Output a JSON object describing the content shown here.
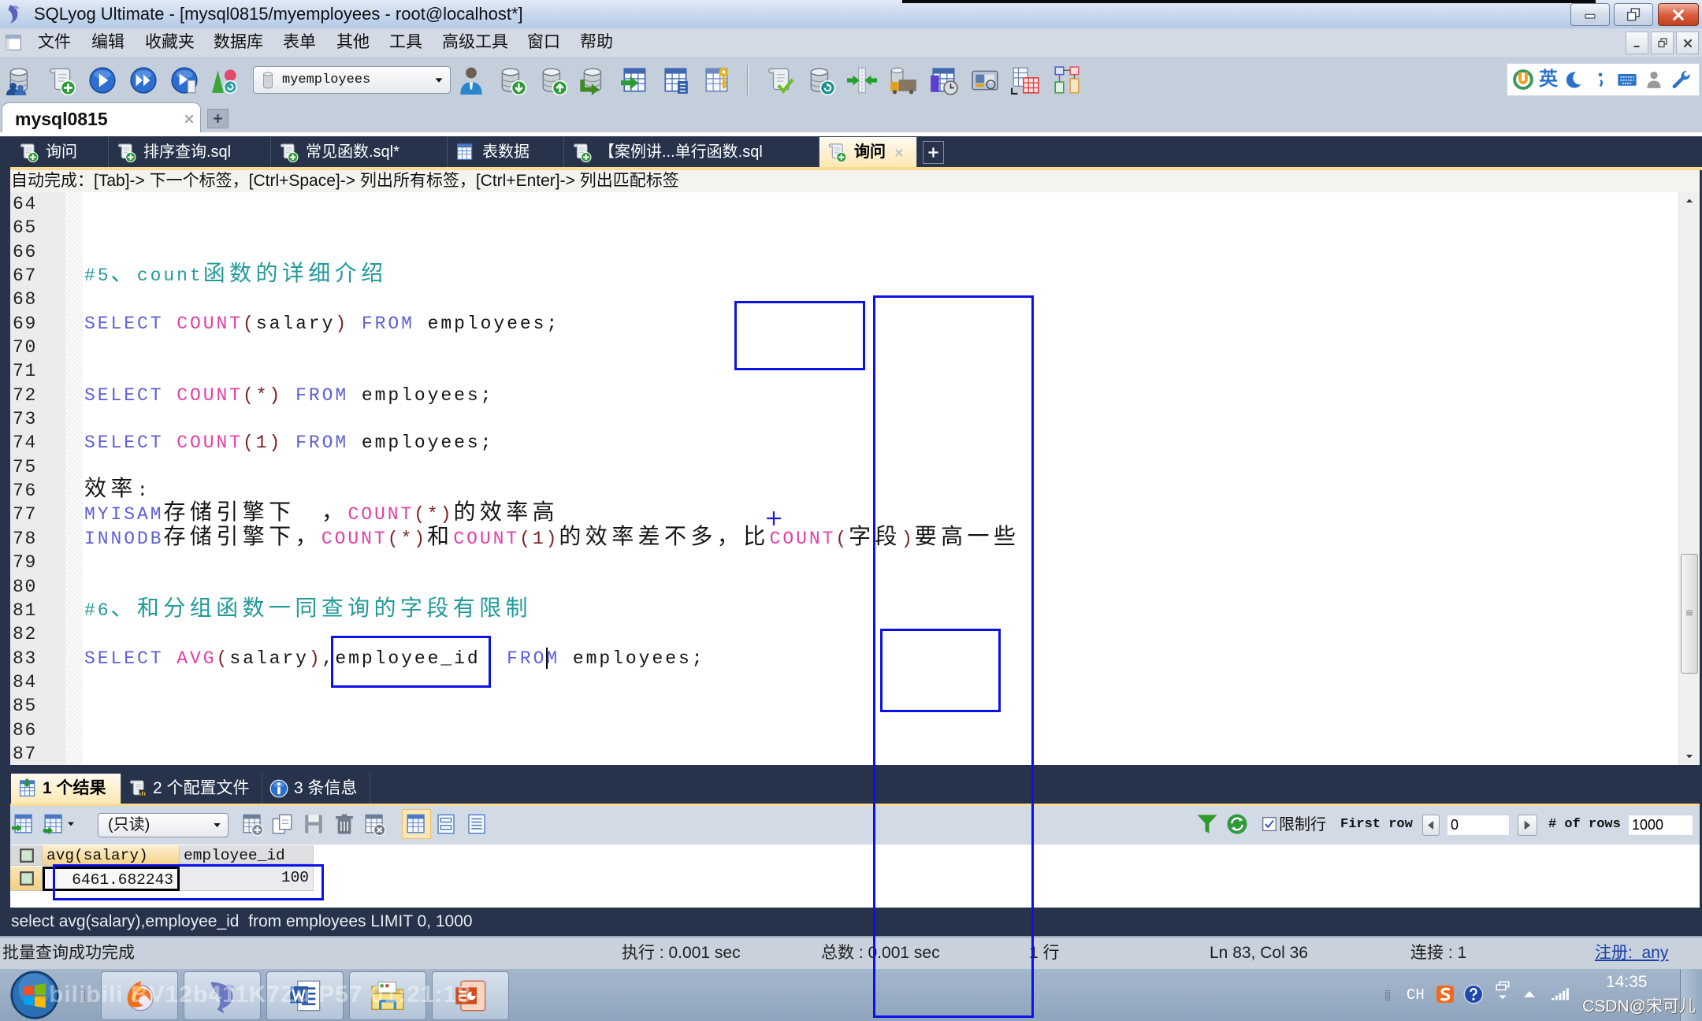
{
  "window": {
    "title": "SQLyog Ultimate - [mysql0815/myemployees - root@localhost*]",
    "app_icon": "sqlyog-logo-icon",
    "controls": [
      "minimize-icon",
      "restore-icon",
      "close-icon"
    ]
  },
  "menu": {
    "items": [
      "文件",
      "编辑",
      "收藏夹",
      "数据库",
      "表单",
      "其他",
      "工具",
      "高级工具",
      "窗口",
      "帮助"
    ]
  },
  "toolbar": {
    "group1": [
      "new-connection-icon",
      "new-query-icon",
      "execute-query-icon",
      "execute-all-queries-icon",
      "execute-and-edit-icon",
      "schema-objects-icon"
    ],
    "database_select": "myemployees",
    "group2": [
      "user-manager-icon",
      "backup-database-icon",
      "restore-database-icon",
      "copy-database-icon",
      "import-table-icon",
      "table-diagnostics-icon",
      "manage-indexes-icon"
    ],
    "group3": [
      "format-sql-icon",
      "refresh-database-icon",
      "schema-sync-icon",
      "import-external-data-icon",
      "scheduled-backup-icon",
      "data-compare-icon",
      "table-designer-icon",
      "schema-designer-icon"
    ]
  },
  "ime_bar": {
    "language": "英",
    "icons": [
      "ime-logo-icon",
      "moon-icon",
      "punctuation-icon",
      "keyboard-icon",
      "user-icon",
      "wrench-icon"
    ]
  },
  "connection_tab": {
    "label": "mysql0815"
  },
  "query_tabs": [
    {
      "label": "询问",
      "icon": "query-file-icon"
    },
    {
      "label": "排序查询.sql",
      "icon": "query-file-icon"
    },
    {
      "label": "常见函数.sql*",
      "icon": "query-file-icon"
    },
    {
      "label": "表数据",
      "icon": "table-data-icon"
    },
    {
      "label": "【案例讲...单行函数.sql",
      "icon": "query-file-icon"
    },
    {
      "label": "询问",
      "icon": "query-file-icon",
      "active": true
    }
  ],
  "editor": {
    "autocomplete_hint": "自动完成：[Tab]-> 下一个标签，[Ctrl+Space]-> 列出所有标签，[Ctrl+Enter]-> 列出匹配标签",
    "cursor": {
      "line": 83,
      "col": 36
    },
    "lines": [
      {
        "n": 64,
        "tokens": []
      },
      {
        "n": 65,
        "tokens": []
      },
      {
        "n": 66,
        "tokens": []
      },
      {
        "n": 67,
        "tokens": [
          [
            "cm",
            "#5、count函数的详细介绍"
          ]
        ]
      },
      {
        "n": 68,
        "tokens": []
      },
      {
        "n": 69,
        "tokens": [
          [
            "kw",
            "SELECT"
          ],
          [
            "tx",
            " "
          ],
          [
            "fn",
            "COUNT"
          ],
          [
            "pn",
            "("
          ],
          [
            "tx",
            "salary"
          ],
          [
            "pn",
            ")"
          ],
          [
            "tx",
            " "
          ],
          [
            "kw",
            "FROM"
          ],
          [
            "tx",
            " employees;"
          ]
        ]
      },
      {
        "n": 70,
        "tokens": []
      },
      {
        "n": 71,
        "tokens": []
      },
      {
        "n": 72,
        "tokens": [
          [
            "kw",
            "SELECT"
          ],
          [
            "tx",
            " "
          ],
          [
            "fn",
            "COUNT"
          ],
          [
            "pn",
            "(*)"
          ],
          [
            "tx",
            " "
          ],
          [
            "kw",
            "FROM"
          ],
          [
            "tx",
            " employees;"
          ]
        ]
      },
      {
        "n": 73,
        "tokens": []
      },
      {
        "n": 74,
        "tokens": [
          [
            "kw",
            "SELECT"
          ],
          [
            "tx",
            " "
          ],
          [
            "fn",
            "COUNT"
          ],
          [
            "pn",
            "(1)"
          ],
          [
            "tx",
            " "
          ],
          [
            "kw",
            "FROM"
          ],
          [
            "tx",
            " employees;"
          ]
        ]
      },
      {
        "n": 75,
        "tokens": []
      },
      {
        "n": 76,
        "tokens": [
          [
            "tx",
            "效率:"
          ]
        ]
      },
      {
        "n": 77,
        "tokens": [
          [
            "kw",
            "MYISAM"
          ],
          [
            "tx",
            "存储引擎下  ，"
          ],
          [
            "fn",
            "COUNT"
          ],
          [
            "pn",
            "(*)"
          ],
          [
            "tx",
            "的效率高"
          ]
        ]
      },
      {
        "n": 78,
        "tokens": [
          [
            "kw",
            "INNODB"
          ],
          [
            "tx",
            "存储引擎下，"
          ],
          [
            "fn",
            "COUNT"
          ],
          [
            "pn",
            "(*)"
          ],
          [
            "tx",
            "和"
          ],
          [
            "fn",
            "COUNT"
          ],
          [
            "pn",
            "(1)"
          ],
          [
            "tx",
            "的效率差不多，比"
          ],
          [
            "fn",
            "COUNT"
          ],
          [
            "pn",
            "("
          ],
          [
            "tx",
            "字段"
          ],
          [
            "pn",
            ")"
          ],
          [
            "tx",
            "要高一些"
          ]
        ]
      },
      {
        "n": 79,
        "tokens": []
      },
      {
        "n": 80,
        "tokens": []
      },
      {
        "n": 81,
        "tokens": [
          [
            "cm",
            "#6、和分组函数一同查询的字段有限制"
          ]
        ]
      },
      {
        "n": 82,
        "tokens": []
      },
      {
        "n": 83,
        "tokens": [
          [
            "kw",
            "SELECT"
          ],
          [
            "tx",
            " "
          ],
          [
            "fn",
            "AVG"
          ],
          [
            "pn",
            "("
          ],
          [
            "tx",
            "salary"
          ],
          [
            "pn",
            ")"
          ],
          [
            "tx",
            ",employee_id  "
          ],
          [
            "kw",
            "FROM"
          ],
          [
            "tx",
            " employees;"
          ]
        ]
      },
      {
        "n": 84,
        "tokens": []
      },
      {
        "n": 85,
        "tokens": []
      },
      {
        "n": 86,
        "tokens": []
      },
      {
        "n": 87,
        "tokens": []
      }
    ]
  },
  "result_tabs": [
    {
      "label": "1 个结果",
      "icon": "result-grid-icon",
      "active": true
    },
    {
      "label": "2 个配置文件",
      "icon": "profile-icon"
    },
    {
      "label": "3 条信息",
      "icon": "info-icon"
    }
  ],
  "result_toolbar": {
    "icons": [
      "export-icon",
      "import-icon",
      "add-row-icon",
      "duplicate-row-icon",
      "save-icon",
      "delete-icon",
      "cancel-icon",
      "grid-view-icon",
      "form-view-icon",
      "text-view-icon",
      "filter-icon",
      "refresh-icon"
    ],
    "mode": "(只读)",
    "limit_rows_label": "限制行",
    "limit_rows_checked": true,
    "first_row_label": "First row",
    "first_row_value": "0",
    "rows_label": "# of rows",
    "rows_value": "1000"
  },
  "result_grid": {
    "columns": [
      "avg(salary)",
      "employee_id"
    ],
    "rows": [
      [
        "6461.682243",
        "100"
      ]
    ],
    "selected_cell": [
      0,
      0
    ]
  },
  "executed_sql": "select avg(salary),employee_id  from employees LIMIT 0, 1000",
  "status_bar": {
    "message": "批量查询成功完成",
    "exec_time": "执行 : 0.001 sec",
    "total_time": "总数 : 0.001 sec",
    "rows": "1 行",
    "position": "Ln 83, Col 36",
    "connections": "连接 : 1",
    "registration": "注册:  any"
  },
  "taskbar": {
    "apps": [
      "firefox-icon",
      "sqlyog-dolphin-icon",
      "word-icon",
      "folder-icon",
      "powerpoint-icon"
    ],
    "tray": {
      "ime": "CH",
      "icons": [
        "sogou-icon",
        "help-icon",
        "window-switch-icon",
        "tray-expand-icon",
        "signal-icon"
      ],
      "clock": "14:35"
    }
  },
  "watermarks": {
    "csdn": "CSDN@宋可儿",
    "bilibili": "bilibili BV12b411K7Zu P57 01:21:18"
  },
  "colors": {
    "keyword": "#5d5fd8",
    "function": "#e33fa4",
    "punctuation": "#7a1f1f",
    "comment": "#229a9b",
    "annotation": "#0a12e8"
  }
}
